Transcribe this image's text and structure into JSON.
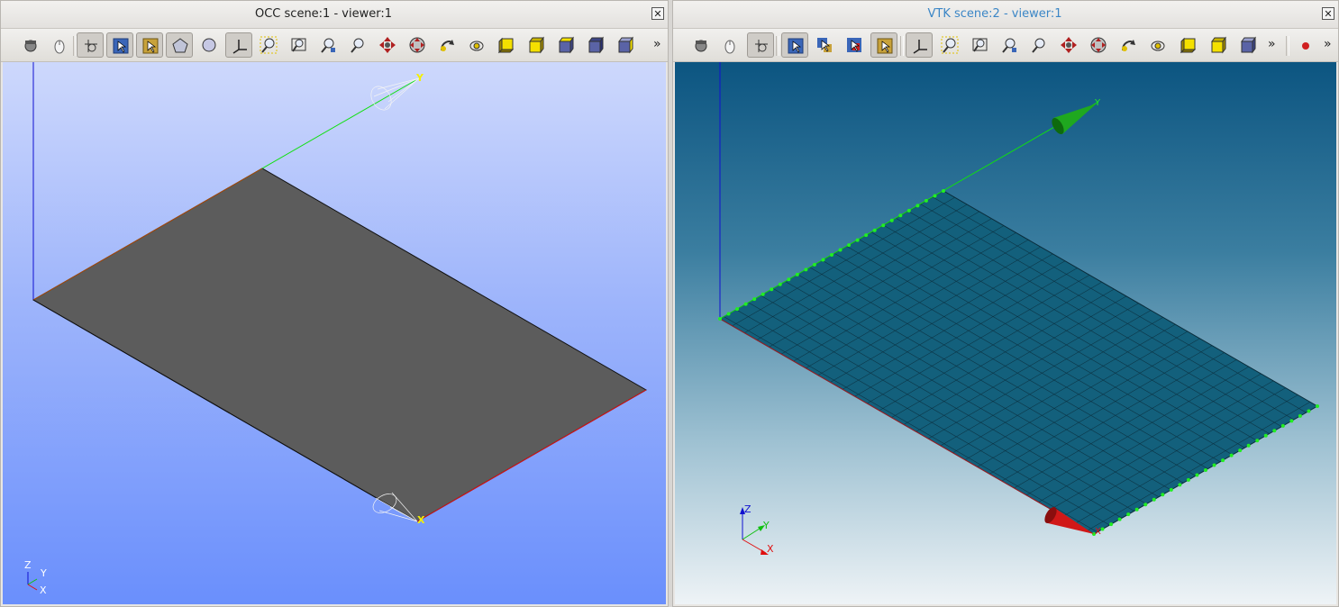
{
  "left_panel": {
    "title": "OCC scene:1 - viewer:1",
    "close_label": "✕",
    "more_label": "»",
    "axis_labels": {
      "x": "X",
      "y": "Y",
      "z": "Z"
    },
    "triedron": {
      "z": "Z",
      "y": "Y",
      "x": "X"
    },
    "toolbar": [
      "dump-view-icon",
      "interaction-style-icon",
      "zoom-style-icon",
      "rectangle-selection-icon",
      "polygon-selection-icon",
      "polygon-icon",
      "circle-icon",
      "show-trihedron-icon",
      "fit-all-icon",
      "fit-area-icon",
      "fit-selection-icon",
      "zoom-icon",
      "pan-icon",
      "global-pan-icon",
      "rotate-icon",
      "rotation-point-icon",
      "front-view-icon",
      "back-view-icon",
      "top-view-icon",
      "bottom-view-icon",
      "left-view-icon"
    ]
  },
  "right_panel": {
    "title": "VTK scene:2 - viewer:1",
    "close_label": "✕",
    "more_label": "»",
    "more_label_2": "»",
    "axis_labels": {
      "x": "X",
      "y": "Y"
    },
    "triedron": {
      "z": "Z",
      "y": "Y",
      "x": "X"
    },
    "toolbar": [
      "dump-view-icon",
      "interaction-style-icon",
      "zoom-style-icon",
      "selection-icon",
      "rectangle-selection-icon",
      "point-selection-icon",
      "element-selection-icon",
      "show-trihedron-icon",
      "fit-all-icon",
      "fit-area-icon",
      "fit-selection-icon",
      "zoom-icon",
      "pan-icon",
      "global-pan-icon",
      "rotate-icon",
      "rotation-point-icon",
      "front-view-icon",
      "back-view-icon",
      "top-view-icon",
      "record-icon"
    ]
  },
  "colors": {
    "occ_plane": "#5c5c5c",
    "vtk_plane": "#13607c",
    "axis_x": "#e01010",
    "axis_y": "#10d010",
    "axis_z": "#1010e0",
    "label_yellow": "#f4f000"
  }
}
